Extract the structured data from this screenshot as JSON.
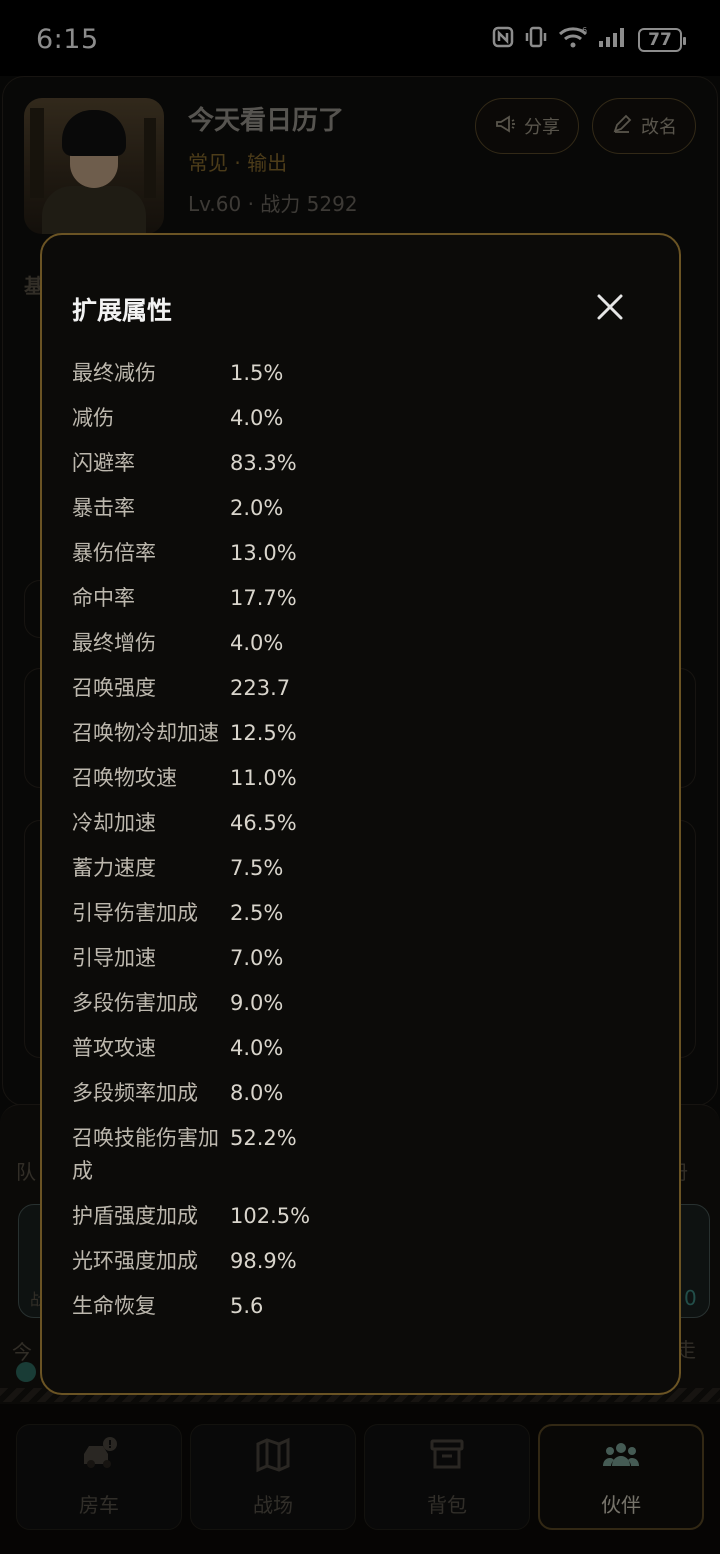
{
  "status_bar": {
    "time": "6:15",
    "battery": "77",
    "icons": [
      "nfc-icon",
      "vibrate-icon",
      "wifi-icon",
      "signal-icon",
      "battery-icon"
    ]
  },
  "profile": {
    "name": "今天看日历了",
    "role": "常见 · 输出",
    "stats": "Lv.60 · 战力 5292",
    "share_label": "分享",
    "rename_label": "改名"
  },
  "background_fragments": {
    "side_char_left_1": "基",
    "side_char_left_2": "队",
    "side_char_left_3": "今",
    "side_char_right_1": "册",
    "side_char_right_2": "走",
    "side_digit_right": "0",
    "side_char_small": "战"
  },
  "modal": {
    "title": "扩展属性",
    "stats": [
      {
        "label": "最终减伤",
        "value": "1.5%"
      },
      {
        "label": "减伤",
        "value": "4.0%"
      },
      {
        "label": "闪避率",
        "value": "83.3%"
      },
      {
        "label": "暴击率",
        "value": "2.0%"
      },
      {
        "label": "暴伤倍率",
        "value": "13.0%"
      },
      {
        "label": "命中率",
        "value": "17.7%"
      },
      {
        "label": "最终增伤",
        "value": "4.0%"
      },
      {
        "label": "召唤强度",
        "value": "223.7"
      },
      {
        "label": "召唤物冷却加速",
        "value": "12.5%"
      },
      {
        "label": "召唤物攻速",
        "value": "11.0%"
      },
      {
        "label": "冷却加速",
        "value": "46.5%"
      },
      {
        "label": "蓄力速度",
        "value": "7.5%"
      },
      {
        "label": "引导伤害加成",
        "value": "2.5%"
      },
      {
        "label": "引导加速",
        "value": "7.0%"
      },
      {
        "label": "多段伤害加成",
        "value": "9.0%"
      },
      {
        "label": "普攻攻速",
        "value": "4.0%"
      },
      {
        "label": "多段频率加成",
        "value": "8.0%"
      },
      {
        "label": "召唤技能伤害加成",
        "value": "52.2%"
      },
      {
        "label": "护盾强度加成",
        "value": "102.5%"
      },
      {
        "label": "光环强度加成",
        "value": "98.9%"
      },
      {
        "label": "生命恢复",
        "value": "5.6"
      }
    ]
  },
  "bottom_nav": {
    "items": [
      {
        "label": "房车",
        "icon": "car-icon"
      },
      {
        "label": "战场",
        "icon": "map-icon"
      },
      {
        "label": "背包",
        "icon": "archive-icon"
      },
      {
        "label": "伙伴",
        "icon": "partners-icon",
        "active": true
      }
    ]
  },
  "colors": {
    "accent_gold": "#6b5424",
    "role_color": "#8a6d2f",
    "active_icon": "#7fa79a"
  }
}
